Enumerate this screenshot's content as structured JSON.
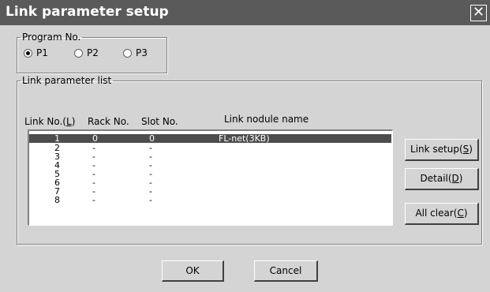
{
  "window": {
    "title": "Link parameter setup",
    "close_glyph": "✕"
  },
  "program": {
    "legend": "Program No.",
    "options": [
      {
        "label": "P1",
        "selected": true
      },
      {
        "label": "P2",
        "selected": false
      },
      {
        "label": "P3",
        "selected": false
      }
    ]
  },
  "link_list": {
    "legend": "Link parameter list",
    "headers": {
      "link_no": "Link No.(",
      "link_no_key": "L",
      "link_no_end": ")",
      "rack": "Rack No.",
      "slot": "Slot No.",
      "module": "Link nodule name"
    },
    "rows": [
      {
        "link": "1",
        "rack": "0",
        "slot": "0",
        "module": "FL-net(3KB)",
        "selected": true
      },
      {
        "link": "2",
        "rack": "-",
        "slot": "-",
        "module": ""
      },
      {
        "link": "3",
        "rack": "-",
        "slot": "-",
        "module": ""
      },
      {
        "link": "4",
        "rack": "-",
        "slot": "-",
        "module": ""
      },
      {
        "link": "5",
        "rack": "-",
        "slot": "-",
        "module": ""
      },
      {
        "link": "6",
        "rack": "-",
        "slot": "-",
        "module": ""
      },
      {
        "link": "7",
        "rack": "-",
        "slot": "-",
        "module": ""
      },
      {
        "link": "8",
        "rack": "-",
        "slot": "-",
        "module": ""
      }
    ]
  },
  "buttons": {
    "link_setup": {
      "text": "Link setup(",
      "key": "S",
      "end": ")"
    },
    "detail": {
      "text": "Detail(",
      "key": "D",
      "end": ")"
    },
    "all_clear": {
      "text": "All clear(",
      "key": "C",
      "end": ")"
    },
    "ok": "OK",
    "cancel": "Cancel"
  }
}
